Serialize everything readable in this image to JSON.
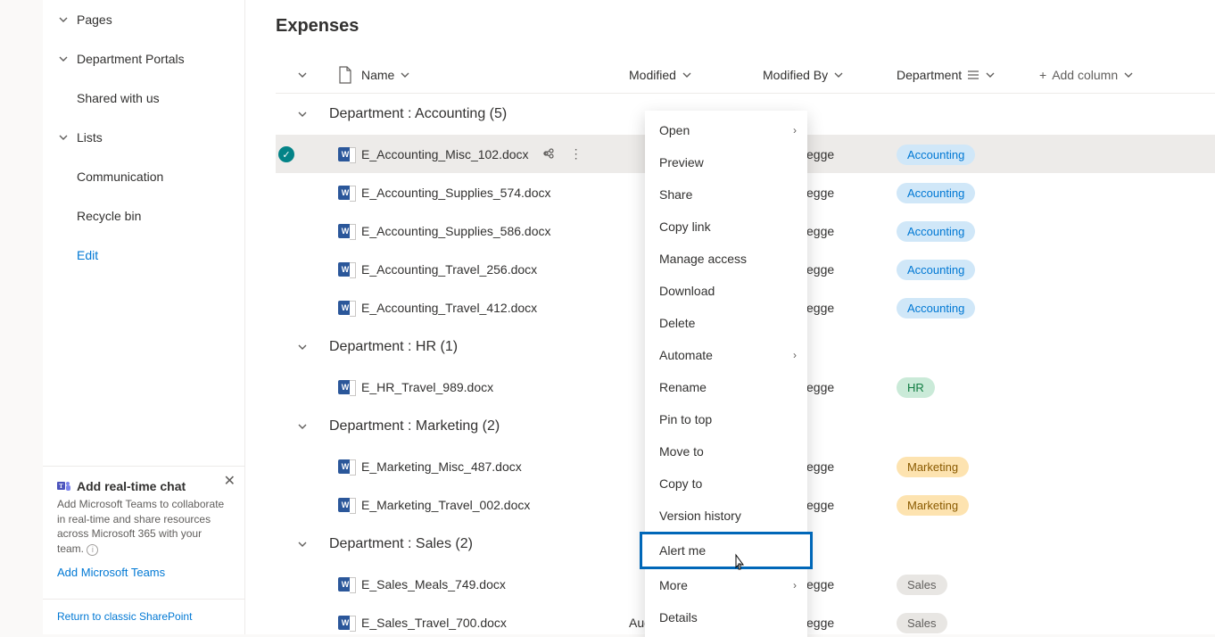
{
  "sidebar": {
    "items": [
      {
        "label": "Pages",
        "hasChevron": true
      },
      {
        "label": "Department Portals",
        "hasChevron": true
      },
      {
        "label": "Shared with us",
        "child": true
      },
      {
        "label": "Lists",
        "hasChevron": true
      },
      {
        "label": "Communication",
        "child": true
      },
      {
        "label": "Recycle bin",
        "child": true
      }
    ],
    "edit_label": "Edit"
  },
  "promo": {
    "title": "Add real-time chat",
    "desc": "Add Microsoft Teams to collaborate in real-time and share resources across Microsoft 365 with your team.",
    "cta": "Add Microsoft Teams"
  },
  "footer_link": "Return to classic SharePoint",
  "page_title": "Expenses",
  "columns": {
    "name": "Name",
    "modified": "Modified",
    "modified_by": "Modified By",
    "department": "Department",
    "add": "Add column"
  },
  "groups": [
    {
      "label": "Department : Accounting (5)",
      "rows": [
        {
          "name": "E_Accounting_Misc_102.docx",
          "by": "Henry Legge",
          "dept": "Accounting",
          "deptClass": "acc",
          "selected": true,
          "modified": ""
        },
        {
          "name": "E_Accounting_Supplies_574.docx",
          "by": "Henry Legge",
          "dept": "Accounting",
          "deptClass": "acc",
          "modified": ""
        },
        {
          "name": "E_Accounting_Supplies_586.docx",
          "by": "Henry Legge",
          "dept": "Accounting",
          "deptClass": "acc",
          "modified": ""
        },
        {
          "name": "E_Accounting_Travel_256.docx",
          "by": "Henry Legge",
          "dept": "Accounting",
          "deptClass": "acc",
          "modified": ""
        },
        {
          "name": "E_Accounting_Travel_412.docx",
          "by": "Henry Legge",
          "dept": "Accounting",
          "deptClass": "acc",
          "modified": ""
        }
      ]
    },
    {
      "label": "Department : HR (1)",
      "rows": [
        {
          "name": "E_HR_Travel_989.docx",
          "by": "Henry Legge",
          "dept": "HR",
          "deptClass": "hr",
          "modified": ""
        }
      ]
    },
    {
      "label": "Department : Marketing (2)",
      "rows": [
        {
          "name": "E_Marketing_Misc_487.docx",
          "by": "Henry Legge",
          "dept": "Marketing",
          "deptClass": "mkt",
          "modified": ""
        },
        {
          "name": "E_Marketing_Travel_002.docx",
          "by": "Henry Legge",
          "dept": "Marketing",
          "deptClass": "mkt",
          "modified": ""
        }
      ]
    },
    {
      "label": "Department : Sales (2)",
      "rows": [
        {
          "name": "E_Sales_Meals_749.docx",
          "by": "Henry Legge",
          "dept": "Sales",
          "deptClass": "sales",
          "modified": ""
        },
        {
          "name": "E_Sales_Travel_700.docx",
          "by": "Henry Legge",
          "dept": "Sales",
          "deptClass": "sales",
          "modified": "August 13"
        }
      ]
    }
  ],
  "context_menu": {
    "items": [
      {
        "label": "Open",
        "sub": true
      },
      {
        "label": "Preview"
      },
      {
        "label": "Share"
      },
      {
        "label": "Copy link"
      },
      {
        "label": "Manage access"
      },
      {
        "label": "Download"
      },
      {
        "label": "Delete"
      },
      {
        "label": "Automate",
        "sub": true
      },
      {
        "label": "Rename"
      },
      {
        "label": "Pin to top"
      },
      {
        "label": "Move to"
      },
      {
        "label": "Copy to"
      },
      {
        "label": "Version history"
      },
      {
        "label": "Alert me",
        "highlight": true
      },
      {
        "label": "More",
        "sub": true
      },
      {
        "label": "Details"
      }
    ]
  }
}
